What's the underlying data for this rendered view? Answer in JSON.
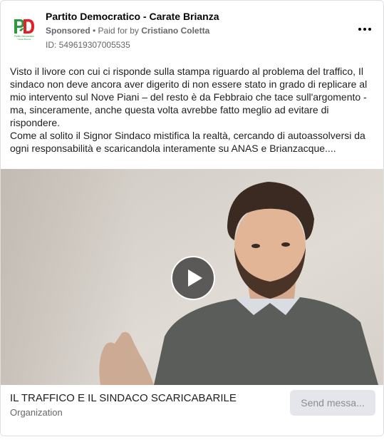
{
  "ad": {
    "page_name": "Partito Democratico - Carate Brianza",
    "sponsored_label": "Sponsored",
    "separator": " • ",
    "paid_for_prefix": "Paid for by ",
    "paid_for_name": "Cristiano Coletta",
    "ad_id": "ID: 549619307005535",
    "more_icon": "more-horizontal-icon"
  },
  "body": {
    "paragraph_1": "Visto il livore con cui ci risponde sulla stampa riguardo al problema del traffico, Il sindaco non deve ancora aver digerito di non essere stato in grado di replicare al mio intervento sul Nove Piani – del resto è da Febbraio che tace sull'argomento - ma, sinceramente, anche questa volta avrebbe fatto meglio ad evitare di rispondere.",
    "paragraph_2": "Come al solito il Signor Sindaco mistifica la realtà, cercando di autoassolversi da ogni responsabilità e scaricandola interamente su ANAS e Brianzacque...."
  },
  "video": {
    "play_icon": "play-icon"
  },
  "footer": {
    "title": "IL TRAFFICO E IL SINDACO SCARICABARILE",
    "subtitle": "Organization",
    "cta_label": "Send messa..."
  },
  "logo": {
    "text_line_1": "Partito Democratico",
    "text_line_2": "Carate Brianza"
  },
  "colors": {
    "logo_red": "#e3202a",
    "logo_green": "#2b9a3f",
    "button_bg": "#e4e6eb",
    "secondary_text": "#65676b"
  }
}
